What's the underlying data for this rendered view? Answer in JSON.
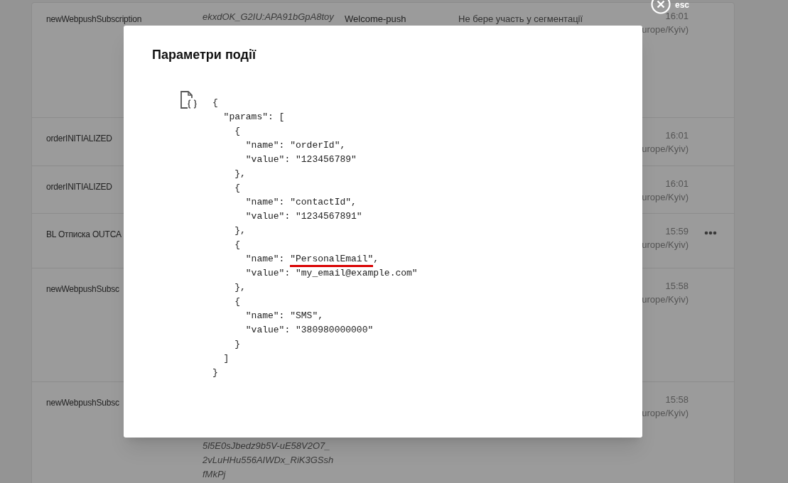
{
  "rows": [
    {
      "event": "newWebpushSubscription",
      "token_lines": [
        "ekxdOK_G2IU:APA91bGpA8toy"
      ],
      "template": "Welcome-push",
      "segmentation": "Не бере участь у сегментації",
      "time": "16:01",
      "timezone": "urope/Kyiv)",
      "menu": false
    },
    {
      "event": "orderINITIALIZED",
      "time": "16:01",
      "timezone": "urope/Kyiv)",
      "menu": false
    },
    {
      "event": "orderINITIALIZED",
      "time": "16:01",
      "timezone": "urope/Kyiv)",
      "menu": false
    },
    {
      "event": "BL Отписка OUTCA",
      "time": "15:59",
      "timezone": "urope/Kyiv)",
      "menu": true
    },
    {
      "event": "newWebpushSubsc",
      "time": "15:58",
      "timezone": "urope/Kyiv)",
      "menu": false
    },
    {
      "event": "newWebpushSubsc",
      "token_lines": [
        "5l5E0sJbedz9b5V-uE58V2O7_",
        "2vLuHHu556AIWDx_RiK3GSsh",
        "fMkPj"
      ],
      "time": "15:58",
      "timezone": "urope/Kyiv)",
      "menu": false
    }
  ],
  "close": {
    "label": "esc"
  },
  "modal": {
    "title": "Параметри події",
    "code_lines": [
      {
        "text": "{"
      },
      {
        "text": "  \"params\": ["
      },
      {
        "text": "    {"
      },
      {
        "text": "      \"name\": \"orderId\","
      },
      {
        "text": "      \"value\": \"123456789\""
      },
      {
        "text": "    },"
      },
      {
        "text": "    {"
      },
      {
        "text": "      \"name\": \"contactId\","
      },
      {
        "text": "      \"value\": \"1234567891\""
      },
      {
        "text": "    },"
      },
      {
        "text": "    {"
      },
      {
        "text": "      \"name\": ",
        "underlined": "\"PersonalEmail\"",
        "after": ","
      },
      {
        "text": "      \"value\": \"my_email@example.com\""
      },
      {
        "text": "    },"
      },
      {
        "text": "    {"
      },
      {
        "text": "      \"name\": \"SMS\","
      },
      {
        "text": "      \"value\": \"380980000000\""
      },
      {
        "text": "    }"
      },
      {
        "text": "  ]"
      },
      {
        "text": "}"
      }
    ]
  }
}
